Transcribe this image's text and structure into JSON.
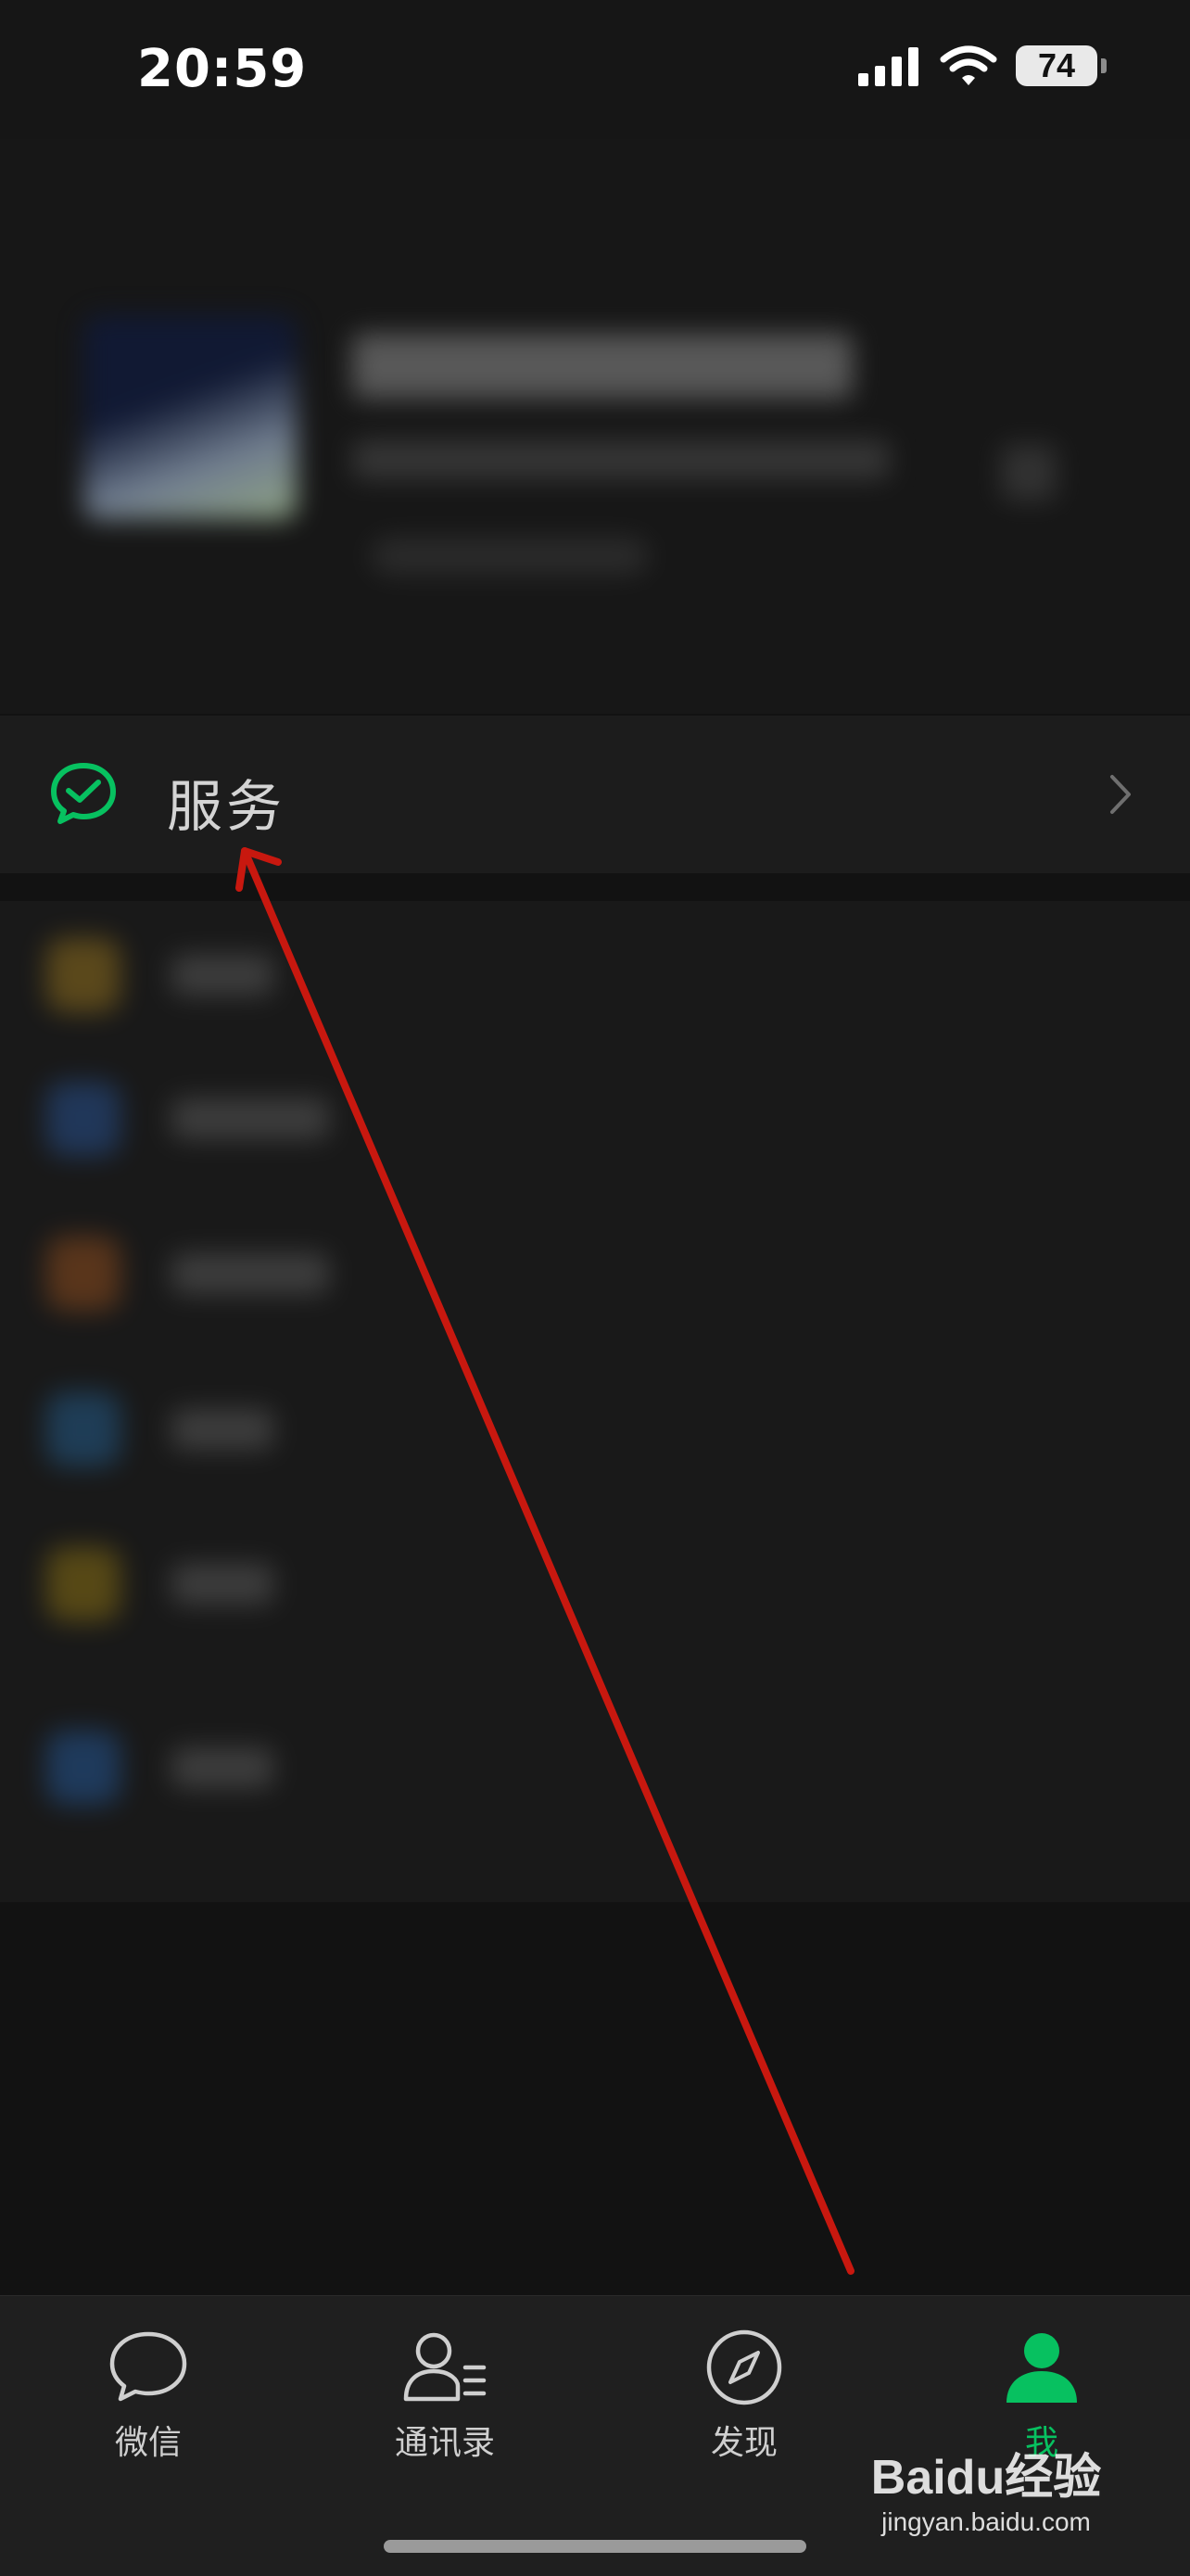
{
  "status_bar": {
    "time": "20:59",
    "battery": "74"
  },
  "service": {
    "label": "服务"
  },
  "tabs": [
    {
      "label": "微信",
      "icon": "chat-bubble-icon"
    },
    {
      "label": "通讯录",
      "icon": "contacts-icon"
    },
    {
      "label": "发现",
      "icon": "compass-icon"
    },
    {
      "label": "我",
      "icon": "person-icon"
    }
  ],
  "active_tab": "我",
  "colors": {
    "accent": "#07c160",
    "annotation_arrow": "#c8180f"
  },
  "watermark": {
    "brand": "Baidu经验",
    "site": "jingyan.baidu.com"
  }
}
